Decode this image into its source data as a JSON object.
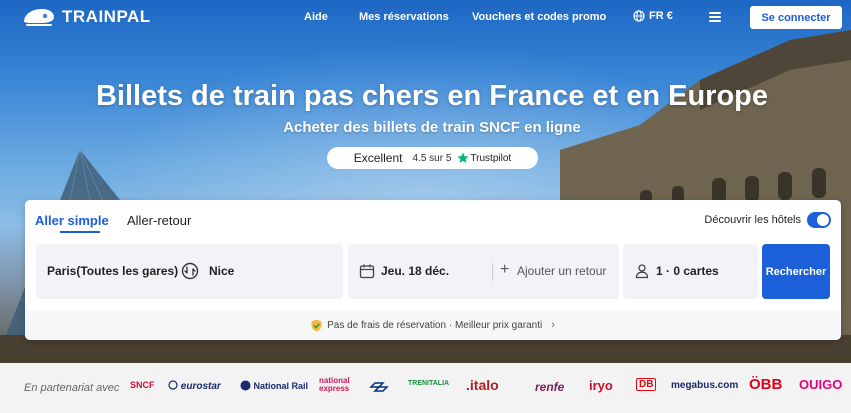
{
  "brand": {
    "name": "TRAINPAL",
    "accent": "#1b5fd9"
  },
  "nav": {
    "help": "Aide",
    "bookings": "Mes réservations",
    "vouchers": "Vouchers et codes promo",
    "lang": "FR €",
    "login": "Se connecter"
  },
  "hero": {
    "title": "Billets de train pas chers en France et en Europe",
    "subtitle": "Acheter des billets de train SNCF en ligne",
    "rating": {
      "label": "Excellent",
      "score": "4.5 sur 5",
      "provider": "Trustpilot"
    }
  },
  "search": {
    "tabs": [
      "Aller simple",
      "Aller-retour"
    ],
    "hotels_label": "Découvrir les hôtels",
    "hotels_enabled": true,
    "from": "Paris(Toutes les gares)",
    "to": "Nice",
    "date": "Jeu. 18 déc.",
    "add_return": "Ajouter un retour",
    "passengers": "1 · 0 cartes",
    "submit": "Rechercher",
    "guarantee": "Pas de frais de réservation · Meilleur prix garanti"
  },
  "partners": {
    "label": "En partenariat avec",
    "logos": [
      {
        "name": "SNCF",
        "text": "SNCF",
        "color": "#c8102e"
      },
      {
        "name": "Eurostar",
        "text": "eurostar",
        "color": "#1a2a6c"
      },
      {
        "name": "National Rail",
        "text": "National Rail",
        "color": "#1a2a6c"
      },
      {
        "name": "National Express",
        "text": "national express",
        "color": "#d4145a"
      },
      {
        "name": "Nederlandse Spoorwegen",
        "text": "NS",
        "color": "#003082"
      },
      {
        "name": "Trenitalia",
        "text": "TRENITALIA",
        "color": "#1b8c3d"
      },
      {
        "name": "Italo",
        "text": ".italo",
        "color": "#b01e23"
      },
      {
        "name": "Renfe",
        "text": "renfe",
        "color": "#7a1f5c"
      },
      {
        "name": "Iryo",
        "text": "iryo",
        "color": "#c8102e"
      },
      {
        "name": "DB",
        "text": "DB",
        "color": "#e30613"
      },
      {
        "name": "Megabus",
        "text": "megabus.com",
        "color": "#1a2a6c"
      },
      {
        "name": "ÖBB",
        "text": "ÖBB",
        "color": "#e2001a"
      },
      {
        "name": "Ouigo",
        "text": "OUIGO",
        "color": "#e6007e"
      }
    ]
  }
}
